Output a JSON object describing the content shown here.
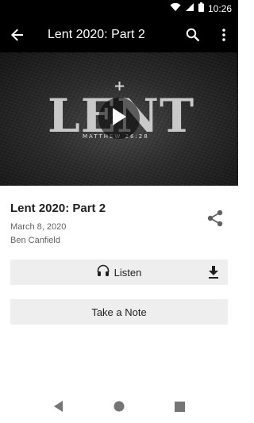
{
  "status_bar": {
    "time": "10:26",
    "icons": [
      "wifi-icon",
      "cell-signal-icon",
      "battery-icon"
    ]
  },
  "app_bar": {
    "title": "Lent 2020: Part 2",
    "back_icon": "arrow-back-icon",
    "search_icon": "search-icon",
    "more_icon": "more-vert-icon"
  },
  "video": {
    "artwork_text": "LENT",
    "artwork_reference": "MATTHEW 26:28",
    "play_icon": "play-icon"
  },
  "sermon": {
    "title": "Lent 2020: Part 2",
    "date": "March 8, 2020",
    "speaker": "Ben Canfield",
    "share_icon": "share-icon"
  },
  "actions": {
    "listen_label": "Listen",
    "listen_icon": "headphones-icon",
    "download_icon": "download-icon",
    "note_label": "Take a Note"
  },
  "nav_bar": {
    "items": [
      "back-triangle-icon",
      "home-circle-icon",
      "recents-square-icon"
    ]
  },
  "colors": {
    "app_bar_bg": "#000000",
    "button_bg": "#eeeeee",
    "text_primary": "#212121",
    "text_secondary": "#616161"
  }
}
